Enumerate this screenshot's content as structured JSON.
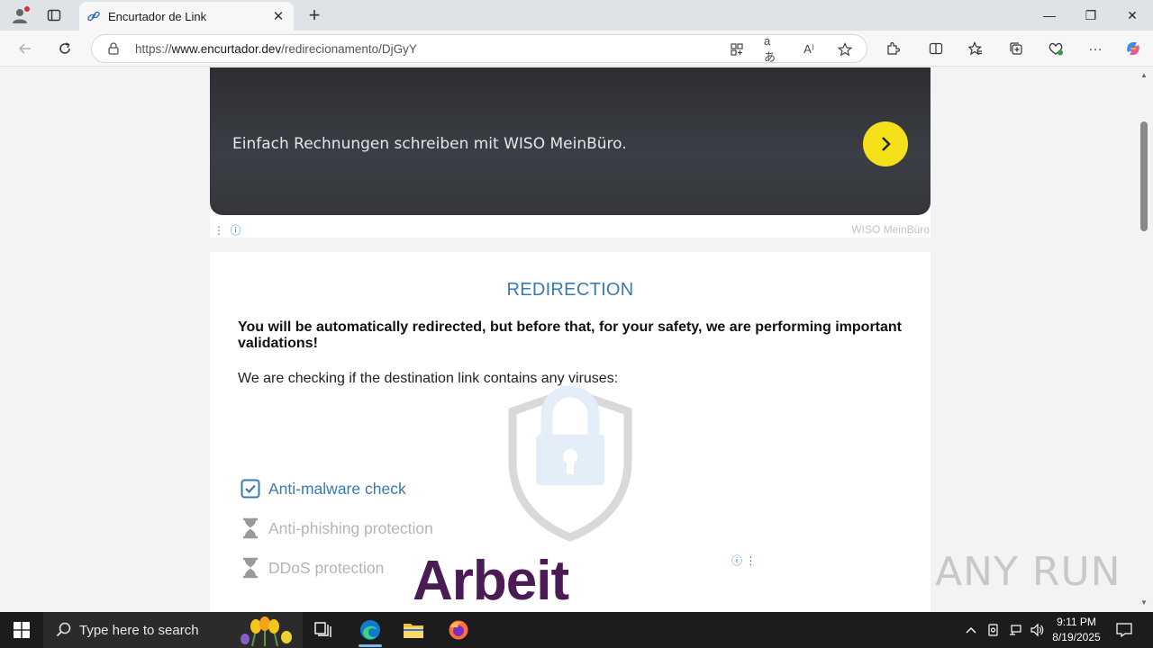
{
  "browser": {
    "tab_title": "Encurtador de Link",
    "url_prefix": "https://",
    "url_domain": "www.encurtador.dev",
    "url_path": "/redirecionamento/DjGyY",
    "minimize": "—",
    "restore": "❐",
    "close": "✕",
    "new_tab": "+"
  },
  "ad_top": {
    "text": "Einfach Rechnungen schreiben mit WISO MeinBüro.",
    "brand": "WISO MeinBüro",
    "accent": "#f5e11a"
  },
  "card": {
    "title": "REDIRECTION",
    "bold_text": "You will be automatically redirected, but before that, for your safety, we are performing important validations!",
    "check_text": "We are checking if the destination link contains any viruses:",
    "items": [
      {
        "label": "Anti-malware check",
        "status": "checked"
      },
      {
        "label": "Anti-phishing protection",
        "status": "pending"
      },
      {
        "label": "DDoS protection",
        "status": "pending"
      }
    ],
    "ad_word": "Arbeit"
  },
  "watermark": "ANY RUN",
  "taskbar": {
    "search_placeholder": "Type here to search",
    "time": "9:11 PM",
    "date": "8/19/2025"
  }
}
